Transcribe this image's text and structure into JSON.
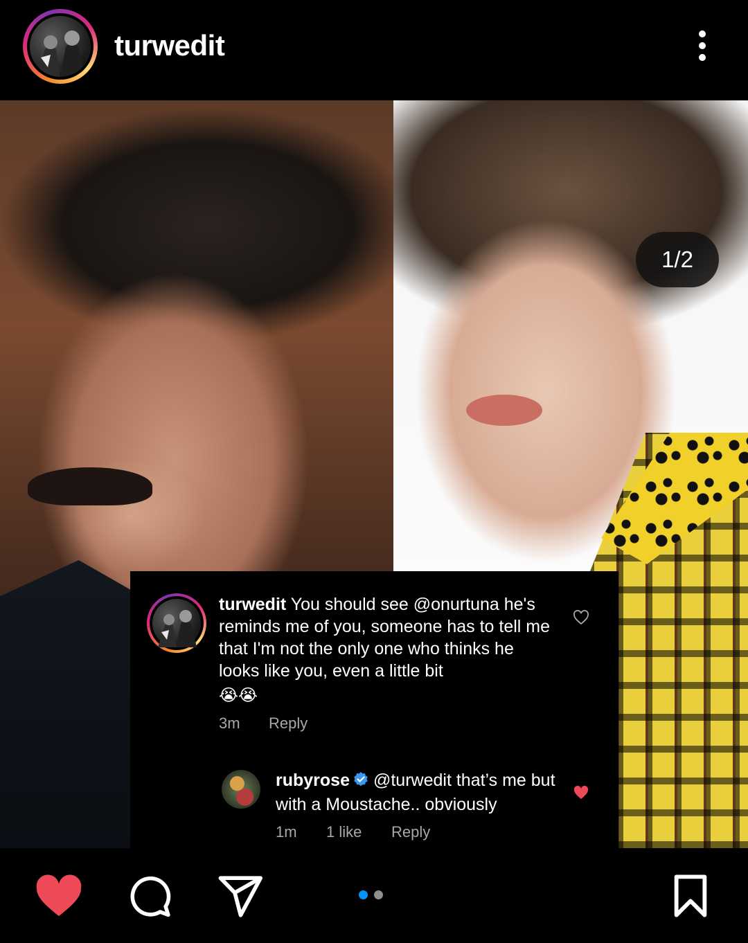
{
  "header": {
    "username": "turwedit",
    "more_icon": "more-vertical-icon"
  },
  "post": {
    "counter": "1/2",
    "slide_index": 1,
    "slide_count": 2,
    "tag_icon": "person-icon"
  },
  "comments": {
    "main": {
      "username": "turwedit",
      "text": "You should see @onurtuna he's reminds me of you, someone has to tell me that I'm not the only one who thinks he looks like you, even a little bit",
      "emoji": "😭😭",
      "time": "3m",
      "reply_label": "Reply",
      "liked": false
    },
    "reply": {
      "username": "rubyrose",
      "verified": true,
      "text": "@turwedit that’s me but with a Moustache.. obviously",
      "time": "1m",
      "likes": "1 like",
      "reply_label": "Reply",
      "liked": true
    }
  },
  "actions": {
    "like_icon": "heart-icon",
    "liked": true,
    "comment_icon": "comment-icon",
    "share_icon": "send-icon",
    "save_icon": "bookmark-icon"
  },
  "colors": {
    "background": "#000000",
    "like_red": "#ed4956",
    "verified_blue": "#3897f0",
    "active_dot": "#0095f6",
    "inactive_dot": "#8e8e8e",
    "meta_gray": "#a8a8a8"
  }
}
